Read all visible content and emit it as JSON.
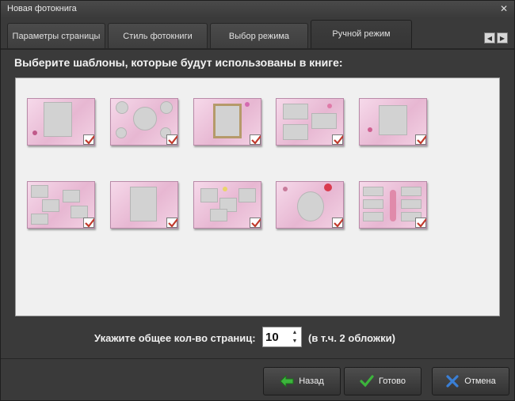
{
  "window": {
    "title": "Новая фотокнига",
    "close_glyph": "✕"
  },
  "tabs": [
    {
      "label": "Параметры страницы"
    },
    {
      "label": "Стиль фотокниги"
    },
    {
      "label": "Выбор режима"
    },
    {
      "label": "Ручной режим",
      "active": true
    }
  ],
  "nav": {
    "prev_glyph": "◀",
    "next_glyph": "▶"
  },
  "prompt": "Выберите шаблоны, которые будут использованы в книге:",
  "templates": [
    {
      "name": "template-1",
      "checked": true
    },
    {
      "name": "template-2",
      "checked": true
    },
    {
      "name": "template-3",
      "checked": true
    },
    {
      "name": "template-4",
      "checked": true
    },
    {
      "name": "template-5",
      "checked": true
    },
    {
      "name": "template-6",
      "checked": true
    },
    {
      "name": "template-7",
      "checked": true
    },
    {
      "name": "template-8",
      "checked": true
    },
    {
      "name": "template-9",
      "checked": true
    },
    {
      "name": "template-10",
      "checked": true
    }
  ],
  "pages": {
    "label": "Укажите общее кол-во страниц:",
    "value": "10",
    "note": "(в т.ч. 2 обложки)"
  },
  "buttons": {
    "back": "Назад",
    "done": "Готово",
    "cancel": "Отмена"
  },
  "colors": {
    "window_bg": "#3a3a3a",
    "panel_bg": "#f0f0f0",
    "check": "#c0392b",
    "back_arrow": "#3cb43c",
    "done_check": "#3cb43c",
    "cancel_x": "#3a7fd5"
  },
  "icons": {
    "back": "arrow-left-icon",
    "done": "checkmark-icon",
    "cancel": "x-icon"
  }
}
